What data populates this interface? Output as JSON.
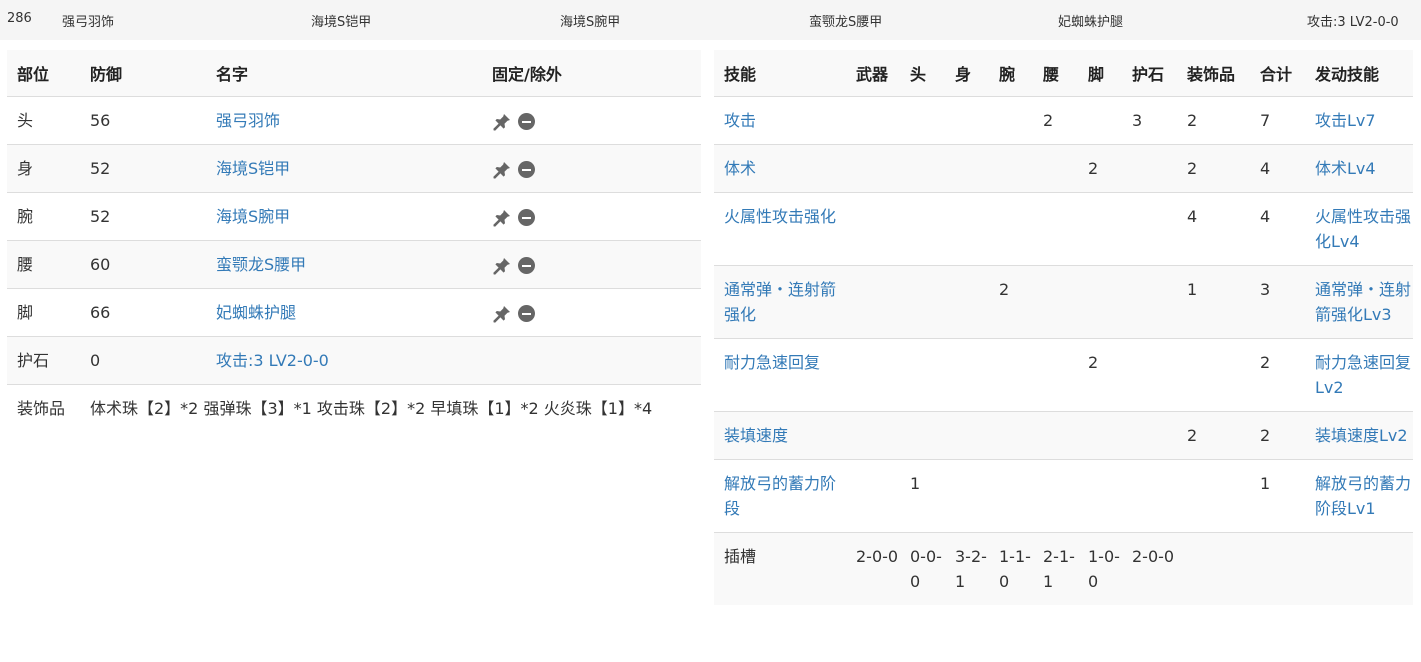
{
  "topbar": {
    "id": "286",
    "head": "强弓羽饰",
    "body": "海境S铠甲",
    "arm": "海境S腕甲",
    "waist": "蛮颚龙S腰甲",
    "leg": "妃蜘蛛护腿",
    "charm": "攻击:3 LV2-0-0"
  },
  "armor_table": {
    "headers": [
      "部位",
      "防御",
      "名字",
      "固定/除外"
    ],
    "rows": [
      {
        "part": "头",
        "defense": "56",
        "name": "强弓羽饰",
        "pin_icon": "pin-icon",
        "exclude_icon": "minus-circle-icon"
      },
      {
        "part": "身",
        "defense": "52",
        "name": "海境S铠甲",
        "pin_icon": "pin-icon",
        "exclude_icon": "minus-circle-icon"
      },
      {
        "part": "腕",
        "defense": "52",
        "name": "海境S腕甲",
        "pin_icon": "pin-icon",
        "exclude_icon": "minus-circle-icon"
      },
      {
        "part": "腰",
        "defense": "60",
        "name": "蛮颚龙S腰甲",
        "pin_icon": "pin-icon",
        "exclude_icon": "minus-circle-icon"
      },
      {
        "part": "脚",
        "defense": "66",
        "name": "妃蜘蛛护腿",
        "pin_icon": "pin-icon",
        "exclude_icon": "minus-circle-icon"
      },
      {
        "part": "护石",
        "defense": "0",
        "name": "攻击:3 LV2-0-0"
      }
    ],
    "decorations_label": "装饰品",
    "decorations_value": "体术珠【2】*2 强弹珠【3】*1 攻击珠【2】*2 早填珠【1】*2 火炎珠【1】*4"
  },
  "skill_table": {
    "headers": [
      "技能",
      "武器",
      "头",
      "身",
      "腕",
      "腰",
      "脚",
      "护石",
      "装饰品",
      "合计",
      "发动技能"
    ],
    "rows": [
      {
        "skill": "攻击",
        "weapon": "",
        "head": "",
        "body": "",
        "arm": "",
        "waist": "2",
        "leg": "",
        "charm": "3",
        "deco": "2",
        "total": "7",
        "active": "攻击Lv7"
      },
      {
        "skill": "体术",
        "weapon": "",
        "head": "",
        "body": "",
        "arm": "",
        "waist": "",
        "leg": "2",
        "charm": "",
        "deco": "2",
        "total": "4",
        "active": "体术Lv4"
      },
      {
        "skill": "火属性攻击强化",
        "weapon": "",
        "head": "",
        "body": "",
        "arm": "",
        "waist": "",
        "leg": "",
        "charm": "",
        "deco": "4",
        "total": "4",
        "active": "火属性攻击强化Lv4"
      },
      {
        "skill": "通常弹・连射箭强化",
        "weapon": "",
        "head": "",
        "body": "",
        "arm": "2",
        "waist": "",
        "leg": "",
        "charm": "",
        "deco": "1",
        "total": "3",
        "active": "通常弹・连射箭强化Lv3"
      },
      {
        "skill": "耐力急速回复",
        "weapon": "",
        "head": "",
        "body": "",
        "arm": "",
        "waist": "",
        "leg": "2",
        "charm": "",
        "deco": "",
        "total": "2",
        "active": "耐力急速回复Lv2"
      },
      {
        "skill": "装填速度",
        "weapon": "",
        "head": "",
        "body": "",
        "arm": "",
        "waist": "",
        "leg": "",
        "charm": "",
        "deco": "2",
        "total": "2",
        "active": "装填速度Lv2"
      },
      {
        "skill": "解放弓的蓄力阶段",
        "weapon": "",
        "head": "1",
        "body": "",
        "arm": "",
        "waist": "",
        "leg": "",
        "charm": "",
        "deco": "",
        "total": "1",
        "active": "解放弓的蓄力阶段Lv1"
      }
    ],
    "slots": {
      "label": "插槽",
      "weapon": "2-0-0",
      "head": "0-0-0",
      "body": "3-2-1",
      "arm": "1-1-0",
      "waist": "2-1-1",
      "leg": "1-0-0",
      "charm": "2-0-0"
    }
  }
}
